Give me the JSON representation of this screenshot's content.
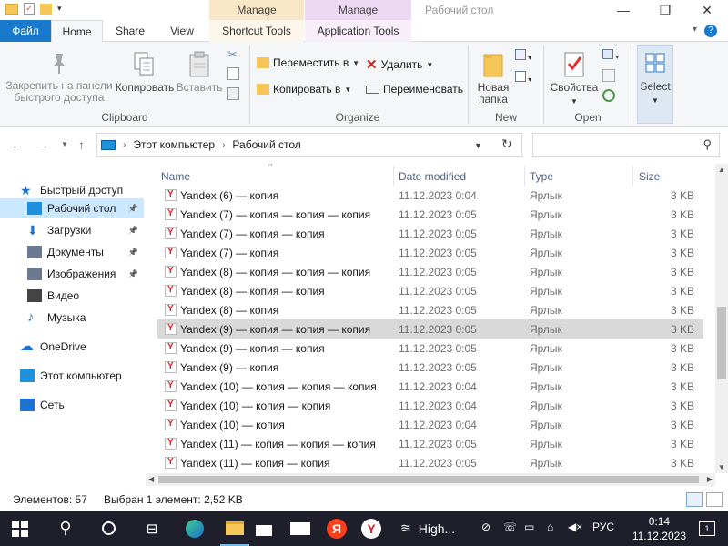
{
  "window": {
    "title": "Рабочий стол",
    "context_tab_1": "Manage",
    "context_tab_2": "Manage",
    "controls": {
      "minimize": "—",
      "maximize": "❐",
      "close": "✕"
    }
  },
  "tabs": {
    "file": "Файл",
    "home": "Home",
    "share": "Share",
    "view": "View",
    "shortcut_tools": "Shortcut Tools",
    "application_tools": "Application Tools"
  },
  "ribbon": {
    "clipboard": {
      "label": "Clipboard",
      "pin": "Закрепить на панели быстрого доступа",
      "copy": "Копировать",
      "paste": "Вставить"
    },
    "organize": {
      "label": "Organize",
      "move_to": "Переместить в",
      "copy_to": "Копировать в",
      "delete": "Удалить",
      "rename": "Переименовать"
    },
    "new": {
      "label": "New",
      "new_folder": "Новая папка"
    },
    "open": {
      "label": "Open",
      "properties": "Свойства"
    },
    "select": {
      "label": "Select"
    }
  },
  "address": {
    "crumbs": [
      "Этот компьютер",
      "Рабочий стол"
    ],
    "search_placeholder": ""
  },
  "nav": {
    "items": [
      {
        "label": "Быстрый доступ",
        "icon": "star-icon",
        "color": "#1e73d2",
        "pinned": false
      },
      {
        "label": "Рабочий стол",
        "icon": "desktop-icon",
        "color": "#1e90e0",
        "pinned": true,
        "selected": true
      },
      {
        "label": "Загрузки",
        "icon": "download-icon",
        "color": "#1e73d2",
        "pinned": true
      },
      {
        "label": "Документы",
        "icon": "documents-icon",
        "color": "#6b7a8f",
        "pinned": true
      },
      {
        "label": "Изображения",
        "icon": "pictures-icon",
        "color": "#6b7a8f",
        "pinned": true
      },
      {
        "label": "Видео",
        "icon": "video-icon",
        "color": "#444",
        "pinned": false
      },
      {
        "label": "Музыка",
        "icon": "music-icon",
        "color": "#1e73d2",
        "pinned": false
      },
      {
        "label": "OneDrive",
        "icon": "onedrive-icon",
        "color": "#1e73d2",
        "pinned": false
      },
      {
        "label": "Этот компьютер",
        "icon": "computer-icon",
        "color": "#1e90e0",
        "pinned": false
      },
      {
        "label": "Сеть",
        "icon": "network-icon",
        "color": "#1e73d2",
        "pinned": false
      }
    ]
  },
  "columns": {
    "name": "Name",
    "date": "Date modified",
    "type": "Type",
    "size": "Size"
  },
  "files": [
    {
      "name": "Yandex (6) — копия",
      "date": "11.12.2023 0:04",
      "type": "Ярлык",
      "size": "3 KB"
    },
    {
      "name": "Yandex (7) — копия — копия — копия",
      "date": "11.12.2023 0:05",
      "type": "Ярлык",
      "size": "3 KB"
    },
    {
      "name": "Yandex (7) — копия — копия",
      "date": "11.12.2023 0:05",
      "type": "Ярлык",
      "size": "3 KB"
    },
    {
      "name": "Yandex (7) — копия",
      "date": "11.12.2023 0:05",
      "type": "Ярлык",
      "size": "3 KB"
    },
    {
      "name": "Yandex (8) — копия — копия — копия",
      "date": "11.12.2023 0:05",
      "type": "Ярлык",
      "size": "3 KB"
    },
    {
      "name": "Yandex (8) — копия — копия",
      "date": "11.12.2023 0:05",
      "type": "Ярлык",
      "size": "3 KB"
    },
    {
      "name": "Yandex (8) — копия",
      "date": "11.12.2023 0:05",
      "type": "Ярлык",
      "size": "3 KB"
    },
    {
      "name": "Yandex (9) — копия — копия — копия",
      "date": "11.12.2023 0:05",
      "type": "Ярлык",
      "size": "3 KB",
      "selected": true
    },
    {
      "name": "Yandex (9) — копия — копия",
      "date": "11.12.2023 0:05",
      "type": "Ярлык",
      "size": "3 KB"
    },
    {
      "name": "Yandex (9) — копия",
      "date": "11.12.2023 0:05",
      "type": "Ярлык",
      "size": "3 KB"
    },
    {
      "name": "Yandex (10) — копия — копия — копия",
      "date": "11.12.2023 0:04",
      "type": "Ярлык",
      "size": "3 KB"
    },
    {
      "name": "Yandex (10) — копия — копия",
      "date": "11.12.2023 0:04",
      "type": "Ярлык",
      "size": "3 KB"
    },
    {
      "name": "Yandex (10) — копия",
      "date": "11.12.2023 0:04",
      "type": "Ярлык",
      "size": "3 KB"
    },
    {
      "name": "Yandex (11) — копия — копия — копия",
      "date": "11.12.2023 0:05",
      "type": "Ярлык",
      "size": "3 KB"
    },
    {
      "name": "Yandex (11) — копия — копия",
      "date": "11.12.2023 0:05",
      "type": "Ярлык",
      "size": "3 KB"
    }
  ],
  "status": {
    "count": "Элементов: 57",
    "selection": "Выбран 1 элемент: 2,52 KB"
  },
  "taskbar": {
    "items": [
      {
        "name": "start-icon"
      },
      {
        "name": "search-icon"
      },
      {
        "name": "cortana-icon"
      },
      {
        "name": "task-view-icon"
      },
      {
        "name": "edge-icon"
      },
      {
        "name": "file-explorer-icon",
        "active": true
      },
      {
        "name": "store-icon"
      },
      {
        "name": "mail-icon"
      },
      {
        "name": "yandex-icon"
      },
      {
        "name": "yandex-browser-icon"
      }
    ],
    "weather": "High...",
    "language": "РУС",
    "time": "0:14",
    "date": "11.12.2023",
    "notifications": "1"
  }
}
